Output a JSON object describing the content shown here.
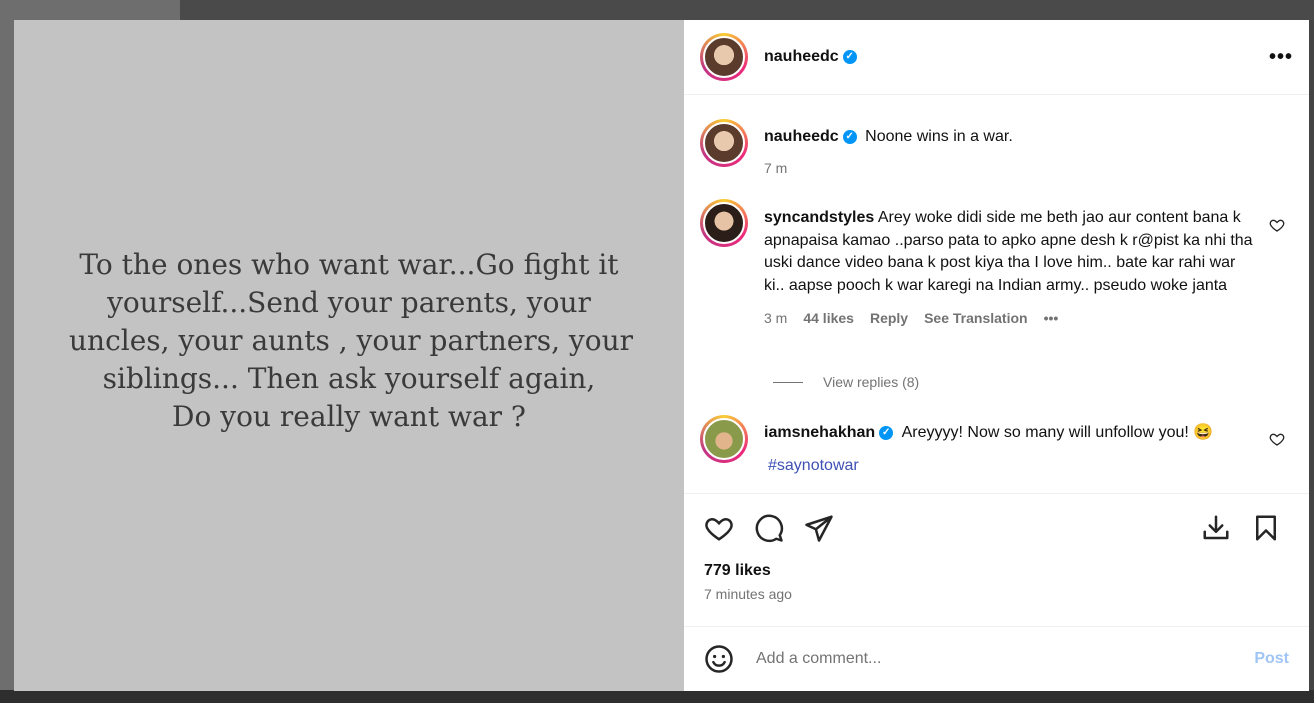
{
  "post": {
    "text_lines": [
      "To the ones who want war...Go fight it",
      "yourself...Send your parents, your",
      "uncles, your aunts , your partners, your",
      "siblings... Then ask yourself again,",
      "Do you really want war ?"
    ]
  },
  "header": {
    "username": "nauheedc",
    "verified_icon": "verified-badge-icon",
    "more_icon": "more-options-icon",
    "more_label": "•••"
  },
  "caption": {
    "username": "nauheedc",
    "text": "Noone wins in a war.",
    "time": "7 m"
  },
  "comments": [
    {
      "username": "syncandstyles",
      "text": "Arey woke didi side me beth jao aur content bana k apnapaisa kamao ..parso pata to apko apne desh k r@pist ka nhi tha uski dance video bana k post kiya tha I love him.. bate kar rahi war ki.. aapse pooch k war karegi na Indian army.. pseudo woke janta",
      "time": "3 m",
      "likes": "44 likes",
      "reply": "Reply",
      "translate": "See Translation",
      "more": "•••",
      "view_replies": "View replies (8)"
    },
    {
      "username": "iamsnehakhan",
      "text": "Areyyyy! Now so many will unfollow you! 😆",
      "hashtag": "#saynotowar"
    }
  ],
  "actions": {
    "like_icon": "heart-icon",
    "comment_icon": "comment-icon",
    "share_icon": "share-icon",
    "download_icon": "download-icon",
    "save_icon": "bookmark-icon"
  },
  "likes": "779 likes",
  "posted_time": "7 minutes ago",
  "comment_box": {
    "emoji_icon": "emoji-icon",
    "placeholder": "Add a comment...",
    "post_label": "Post"
  },
  "colors": {
    "accent": "#0095f6",
    "hashtag": "#3f51b5",
    "post_button": "#a0c5f5",
    "media_bg": "#c3c3c3"
  }
}
